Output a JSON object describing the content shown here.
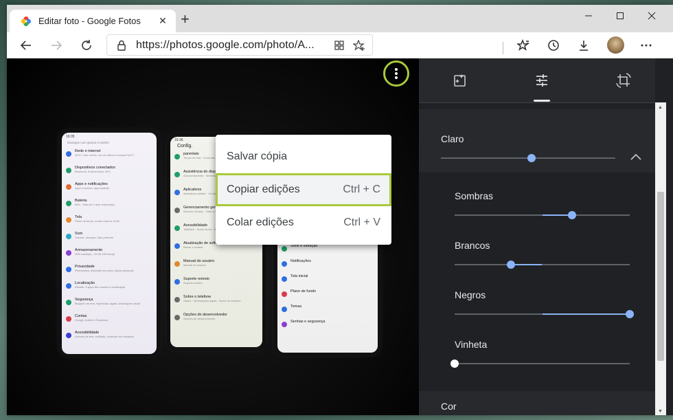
{
  "browser": {
    "tab_title": "Editar foto - Google Fotos",
    "url": "https://photos.google.com/photo/A..."
  },
  "viewer": {
    "more_menu": {
      "items": [
        {
          "label": "Salvar cópia",
          "shortcut": ""
        },
        {
          "label": "Copiar edições",
          "shortcut": "Ctrl + C"
        },
        {
          "label": "Colar edições",
          "shortcut": "Ctrl + V"
        }
      ],
      "highlighted": 1
    }
  },
  "edit_panel": {
    "active_tab": 1,
    "tabs": [
      "auto-fix-icon",
      "adjust-sliders-icon",
      "crop-rotate-icon"
    ],
    "sections": {
      "light": {
        "label": "Claro",
        "value": 0.52,
        "expanded": true
      },
      "color": {
        "label": "Cor"
      }
    },
    "sliders": [
      {
        "label": "Sombras",
        "value": 0.67,
        "fill_from": 0.5
      },
      {
        "label": "Brancos",
        "value": 0.32,
        "fill_from": 0.5
      },
      {
        "label": "Negros",
        "value": 1.0,
        "fill_from": 0.5
      },
      {
        "label": "Vinheta",
        "value": 0.0,
        "fill_from": 0.0
      }
    ]
  },
  "colors": {
    "accent_highlight": "#a9c93b",
    "slider_blue": "#8ab4f8",
    "panel_bg": "#202124"
  },
  "phones": {
    "left": {
      "time": "16:35",
      "search": "Navegue com gestos e botões",
      "rows": [
        {
          "title": "Rede e internet",
          "sub": "Wi-Fi, rede móvel, uso de dados e hotspot Wi-Fi",
          "color": "#2f6fe0"
        },
        {
          "title": "Dispositivos conectados",
          "sub": "Bluetooth, Android Auto, NFC",
          "color": "#1e9e67"
        },
        {
          "title": "Apps e notificações",
          "sub": "Apps recentes, apps padrão",
          "color": "#e06a2f"
        },
        {
          "title": "Bateria",
          "sub": "65% - Mais de 2 dias restante(s)",
          "color": "#1e9e67"
        },
        {
          "title": "Tela",
          "sub": "Plano de fundo, modo noturno, fonte",
          "color": "#e08a2f"
        },
        {
          "title": "Som",
          "sub": "Volume, vibração, Não perturbe",
          "color": "#2aa8c2"
        },
        {
          "title": "Armazenamento",
          "sub": "39% usado(s) - 83,35 GB livre(s)",
          "color": "#8a3fd1"
        },
        {
          "title": "Privacidade",
          "sub": "Permissões, atividade da conta, dados pessoais",
          "color": "#2f6fe0"
        },
        {
          "title": "Localização",
          "sub": "Ativado: 6 apps têm acesso à localização",
          "color": "#2f6fe0"
        },
        {
          "title": "Segurança",
          "sub": "Bloqueio de tela, impressão digital, desbloqueio facial",
          "color": "#1e9e67"
        },
        {
          "title": "Contas",
          "sub": "Google, Adobe e Facebook",
          "color": "#d93a4a"
        },
        {
          "title": "Acessibilidade",
          "sub": "Leitores de tela, exibição, controles de interação",
          "color": "#3a3fd1"
        }
      ]
    },
    "middle": {
      "time": "16:36",
      "header": "Config.",
      "rows": [
        {
          "title": "parentais",
          "sub": "Tempo de tela · Controles de apps",
          "color": "#1e9e67"
        },
        {
          "title": "Assistência do dispositivo",
          "sub": "Armazenamento · Memória · Proteção",
          "color": "#1e9e67"
        },
        {
          "title": "Aplicativos",
          "sub": "Aplicativos padrão · Configurações do aplicativo",
          "color": "#2f6fe0"
        },
        {
          "title": "Gerenciamento geral",
          "sub": "Idioma e teclado · Data e hora",
          "color": "#6a6a6a"
        },
        {
          "title": "Acessibilidade",
          "sub": "TalkBack · Áudio mono · Menu assistente",
          "color": "#1e9e67"
        },
        {
          "title": "Atualização de software",
          "sub": "Baixar e instalar",
          "color": "#2f6fe0"
        },
        {
          "title": "Manual do usuário",
          "sub": "Manual do usuário",
          "color": "#e08a2f"
        },
        {
          "title": "Suporte remoto",
          "sub": "Suporte remoto",
          "color": "#2f6fe0"
        },
        {
          "title": "Sobre o telefone",
          "sub": "Status · Informações legais · Nome do telefone",
          "color": "#6a6a6a"
        },
        {
          "title": "Opções do desenvolvedor",
          "sub": "Opções do desenvolvedor",
          "color": "#6a6a6a"
        }
      ]
    },
    "right": {
      "rows": [
        {
          "title": "Conexão e compartilhamento",
          "color": "#e04a2f"
        },
        {
          "title": "Tela de bloqueio",
          "color": "#d93a4a"
        },
        {
          "title": "Tela",
          "color": "#e0b02f"
        },
        {
          "title": "Sons e vibração",
          "color": "#1e9e67"
        },
        {
          "title": "Notificações",
          "color": "#2f6fe0"
        },
        {
          "title": "Tela inicial",
          "color": "#2f6fe0"
        },
        {
          "title": "Plano de fundo",
          "color": "#d93a4a"
        },
        {
          "title": "Temas",
          "color": "#2f6fe0"
        },
        {
          "title": "Senhas e segurança",
          "color": "#8a3fd1"
        }
      ]
    }
  }
}
